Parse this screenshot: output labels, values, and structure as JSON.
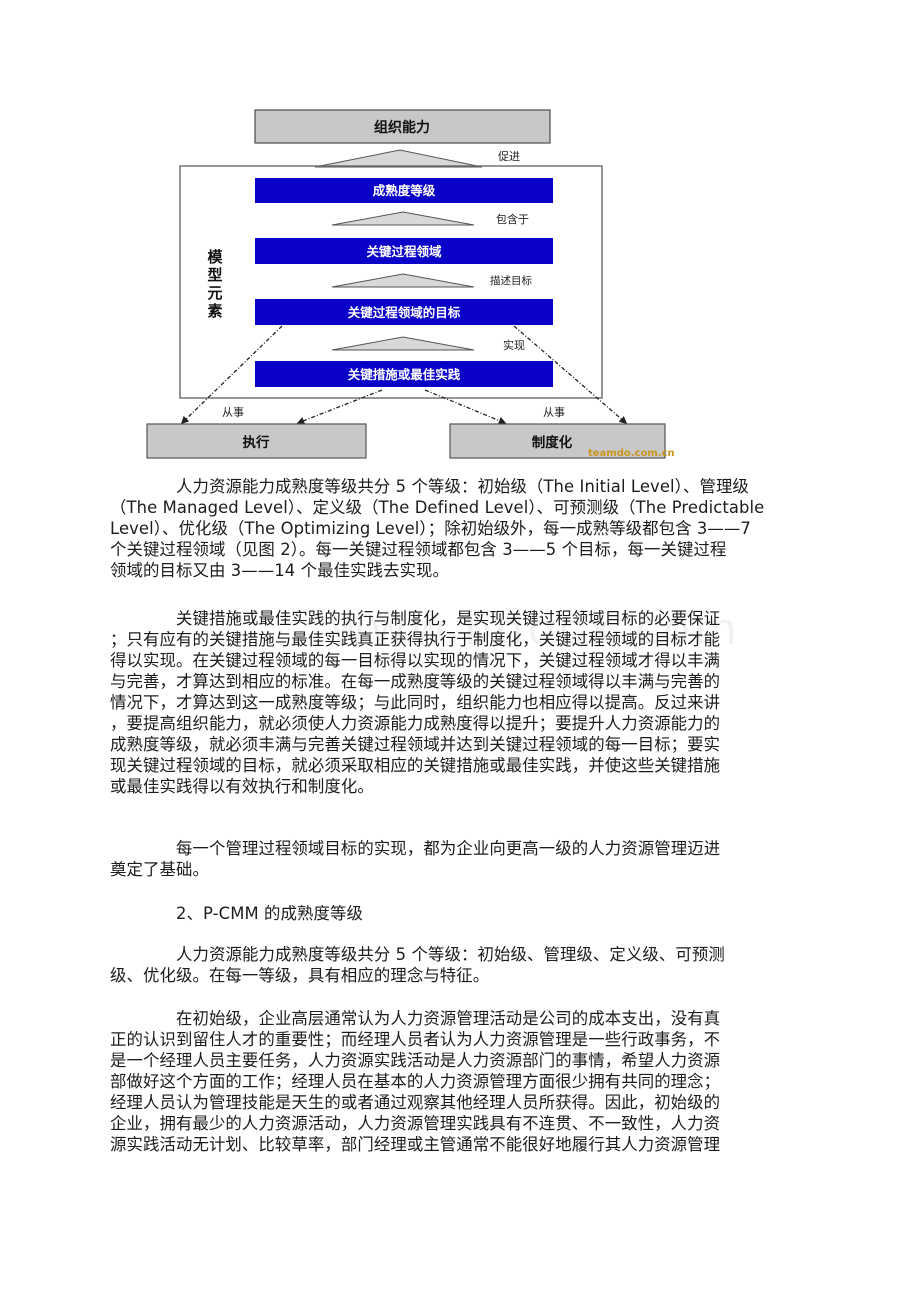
{
  "diagram": {
    "top_box": "组织能力",
    "frame_label": "模型元素",
    "bars": [
      "成熟度等级",
      "关键过程领域",
      "关键过程领域的目标",
      "关键措施或最佳实践"
    ],
    "relations": {
      "promotes": "促进",
      "contained_in": "包含于",
      "describes_goals": "描述目标",
      "realizes": "实现"
    },
    "engage_label_left": "从事",
    "engage_label_right": "从事",
    "bottom_left_box": "执行",
    "bottom_right_box": "制度化",
    "watermark": "teamdo.com.cn",
    "colors": {
      "bar_blue": "#0a00c8",
      "box_gray": "#c8c8c8",
      "triangle_gray": "#d4d4d4",
      "watermark_gold": "#c8961e"
    }
  },
  "faint_watermark": "www.bdocx.com",
  "paragraphs": [
    {
      "lines": [
        "人力资源能力成熟度等级共分 5 个等级：初始级（The Initial Level）、管理级",
        "（The Managed Level）、定义级（The Defined Level）、可预测级（The Predictable",
        "Level）、优化级（The Optimizing Level）；除初始级外，每一成熟等级都包含 3——7",
        "个关键过程领域（见图 2）。每一关键过程领域都包含 3——5 个目标，每一关键过程",
        "领域的目标又由 3——14 个最佳实践去实现。"
      ]
    },
    {
      "lines": [
        "关键措施或最佳实践的执行与制度化，是实现关键过程领域目标的必要保证",
        "；只有应有的关键措施与最佳实践真正获得执行于制度化，关键过程领域的目标才能",
        "得以实现。在关键过程领域的每一目标得以实现的情况下，关键过程领域才得以丰满",
        "与完善，才算达到相应的标准。在每一成熟度等级的关键过程领域得以丰满与完善的",
        "情况下，才算达到这一成熟度等级；与此同时，组织能力也相应得以提高。反过来讲",
        "，要提高组织能力，就必须使人力资源能力成熟度得以提升；要提升人力资源能力的",
        "成熟度等级，就必须丰满与完善关键过程领域并达到关键过程领域的每一目标；要实",
        "现关键过程领域的目标，就必须采取相应的关键措施或最佳实践，并使这些关键措施",
        "或最佳实践得以有效执行和制度化。"
      ]
    },
    {
      "lines": [
        "每一个管理过程领域目标的实现，都为企业向更高一级的人力资源管理迈进",
        "奠定了基础。"
      ]
    },
    {
      "lines": [
        "2、P-CMM 的成熟度等级"
      ]
    },
    {
      "lines": [
        "人力资源能力成熟度等级共分 5 个等级：初始级、管理级、定义级、可预测",
        "级、优化级。在每一等级，具有相应的理念与特征。"
      ]
    },
    {
      "lines": [
        "在初始级，企业高层通常认为人力资源管理活动是公司的成本支出，没有真",
        "正的认识到留住人才的重要性；而经理人员者认为人力资源管理是一些行政事务，不",
        "是一个经理人员主要任务，人力资源实践活动是人力资源部门的事情，希望人力资源",
        "部做好这个方面的工作；经理人员在基本的人力资源管理方面很少拥有共同的理念；",
        "经理人员认为管理技能是天生的或者通过观察其他经理人员所获得。因此，初始级的",
        "企业，拥有最少的人力资源活动，人力资源管理实践具有不连贯、不一致性，人力资",
        "源实践活动无计划、比较草率，部门经理或主管通常不能很好地履行其人力资源管理"
      ]
    }
  ]
}
